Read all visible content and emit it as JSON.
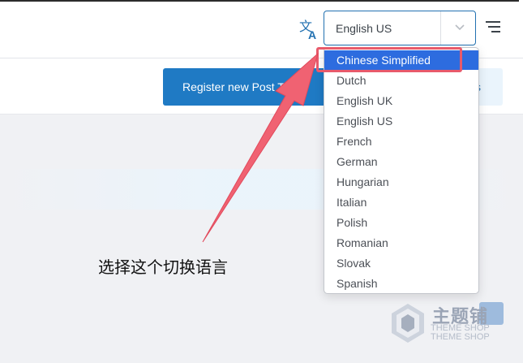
{
  "header": {
    "language_select": {
      "value": "English US"
    }
  },
  "toolbar": {
    "register_button_label": "Register new Post Type",
    "secondary_button_label": "s"
  },
  "dropdown": {
    "options": [
      {
        "label": "Chinese Simplified",
        "selected": true
      },
      {
        "label": "Dutch"
      },
      {
        "label": "English UK"
      },
      {
        "label": "English US"
      },
      {
        "label": "French"
      },
      {
        "label": "German"
      },
      {
        "label": "Hungarian"
      },
      {
        "label": "Italian"
      },
      {
        "label": "Polish"
      },
      {
        "label": "Romanian"
      },
      {
        "label": "Slovak"
      },
      {
        "label": "Spanish"
      }
    ]
  },
  "annotation": {
    "caption": "选择这个切换语言",
    "color": "#e85a6b"
  },
  "watermark": {
    "cn": "主题铺",
    "en_line1": "THEME SHOP",
    "en_line2": "THEME SHOP"
  },
  "colors": {
    "primary": "#1f7ac4",
    "selected_option": "#2d6cdf",
    "annotation": "#e85a6b"
  },
  "icons": [
    "translate-icon",
    "chevron-down-icon",
    "menu-icon",
    "watermark-logo-icon"
  ]
}
